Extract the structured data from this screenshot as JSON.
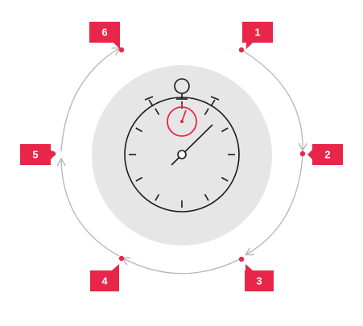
{
  "colors": {
    "accent": "#e8264a",
    "arrow": "#b5b5b5",
    "disc": "#e6e6e6",
    "ink": "#1a1a1a",
    "label_text": "#ffffff"
  },
  "icon": "stopwatch-icon",
  "steps": [
    {
      "label": "1"
    },
    {
      "label": "2"
    },
    {
      "label": "3"
    },
    {
      "label": "4"
    },
    {
      "label": "5"
    },
    {
      "label": "6"
    }
  ]
}
